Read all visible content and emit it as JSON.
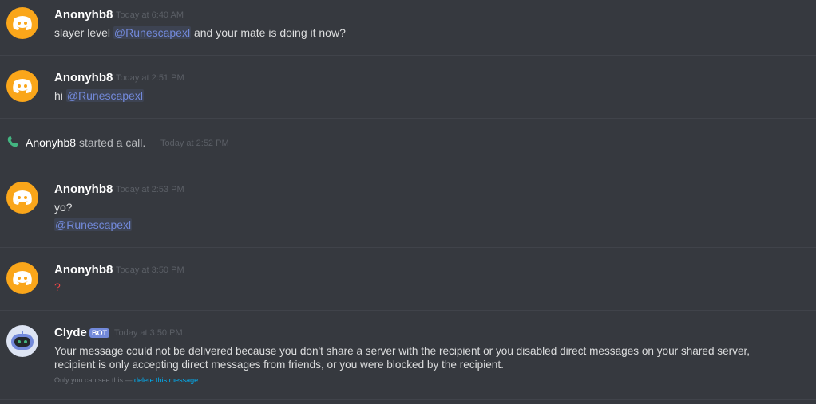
{
  "messages": [
    {
      "author": "Anonyhb8",
      "timestamp": "Today at 6:40 AM",
      "text_before": "slayer level ",
      "mention": "@Runescapexl",
      "text_after": " and your mate is doing it now?"
    },
    {
      "author": "Anonyhb8",
      "timestamp": "Today at 2:51 PM",
      "text_before": "hi ",
      "mention": "@Runescapexl"
    },
    {
      "author": "Anonyhb8",
      "timestamp": "Today at 2:53 PM",
      "line1": "yo?",
      "mention": "@Runescapexl"
    },
    {
      "author": "Anonyhb8",
      "timestamp": "Today at 3:50 PM",
      "text": "?"
    },
    {
      "author": "Clyde",
      "badge": "BOT",
      "timestamp": "Today at 3:50 PM",
      "line1": "Your message could not be delivered because you don't share a server with the recipient or you disabled direct messages on your shared server,",
      "line2": "recipient is only accepting direct messages from friends, or you were blocked by the recipient.",
      "ephemeral_note": "Only you can see this — ",
      "ephemeral_link": "delete this message."
    }
  ],
  "call_event": {
    "author": "Anonyhb8",
    "text": " started a call.",
    "timestamp": "Today at 2:52 PM",
    "icon": "phone-icon"
  },
  "colors": {
    "background": "#36393f",
    "mention": "#7289da",
    "avatar_orange": "#faa61a",
    "bot_badge": "#7289da",
    "call_icon": "#43b581",
    "link": "#00b0f4",
    "red_question": "#f04747"
  }
}
